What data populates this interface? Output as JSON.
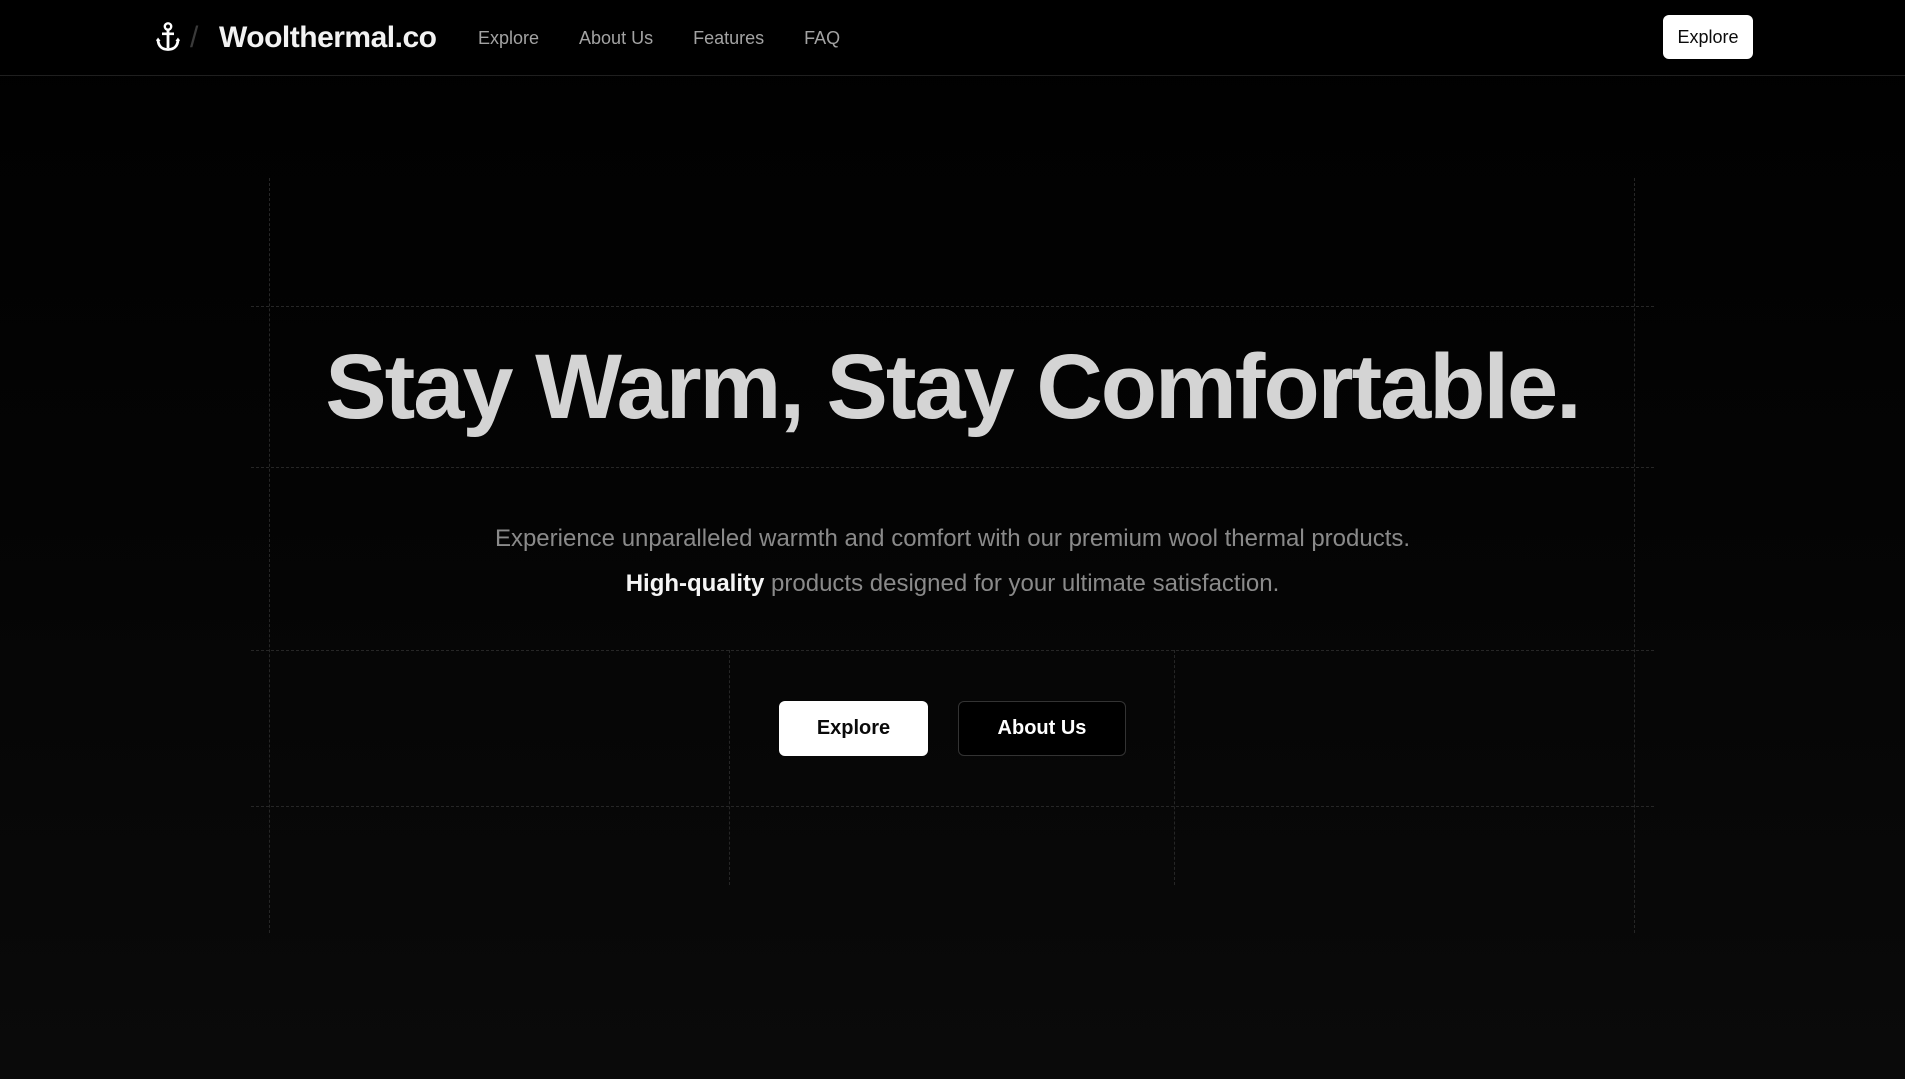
{
  "header": {
    "logo_icon": "anchor-icon",
    "separator": "/",
    "brand": "Woolthermal.co",
    "nav": [
      "Explore",
      "About Us",
      "Features",
      "FAQ"
    ],
    "cta_label": "Explore"
  },
  "hero": {
    "title": "Stay Warm, Stay Comfortable.",
    "subtitle_line1": "Experience unparalleled warmth and comfort with our premium wool thermal products.",
    "subtitle_highlight": "High-quality",
    "subtitle_line2_rest": " products designed for your ultimate satisfaction.",
    "primary_button": "Explore",
    "secondary_button": "About Us"
  },
  "colors": {
    "background": "#000000",
    "title": "#d4d4d4",
    "subtitle": "#8a8a8a",
    "button_primary_bg": "#ffffff",
    "button_secondary_bg": "#000000"
  }
}
